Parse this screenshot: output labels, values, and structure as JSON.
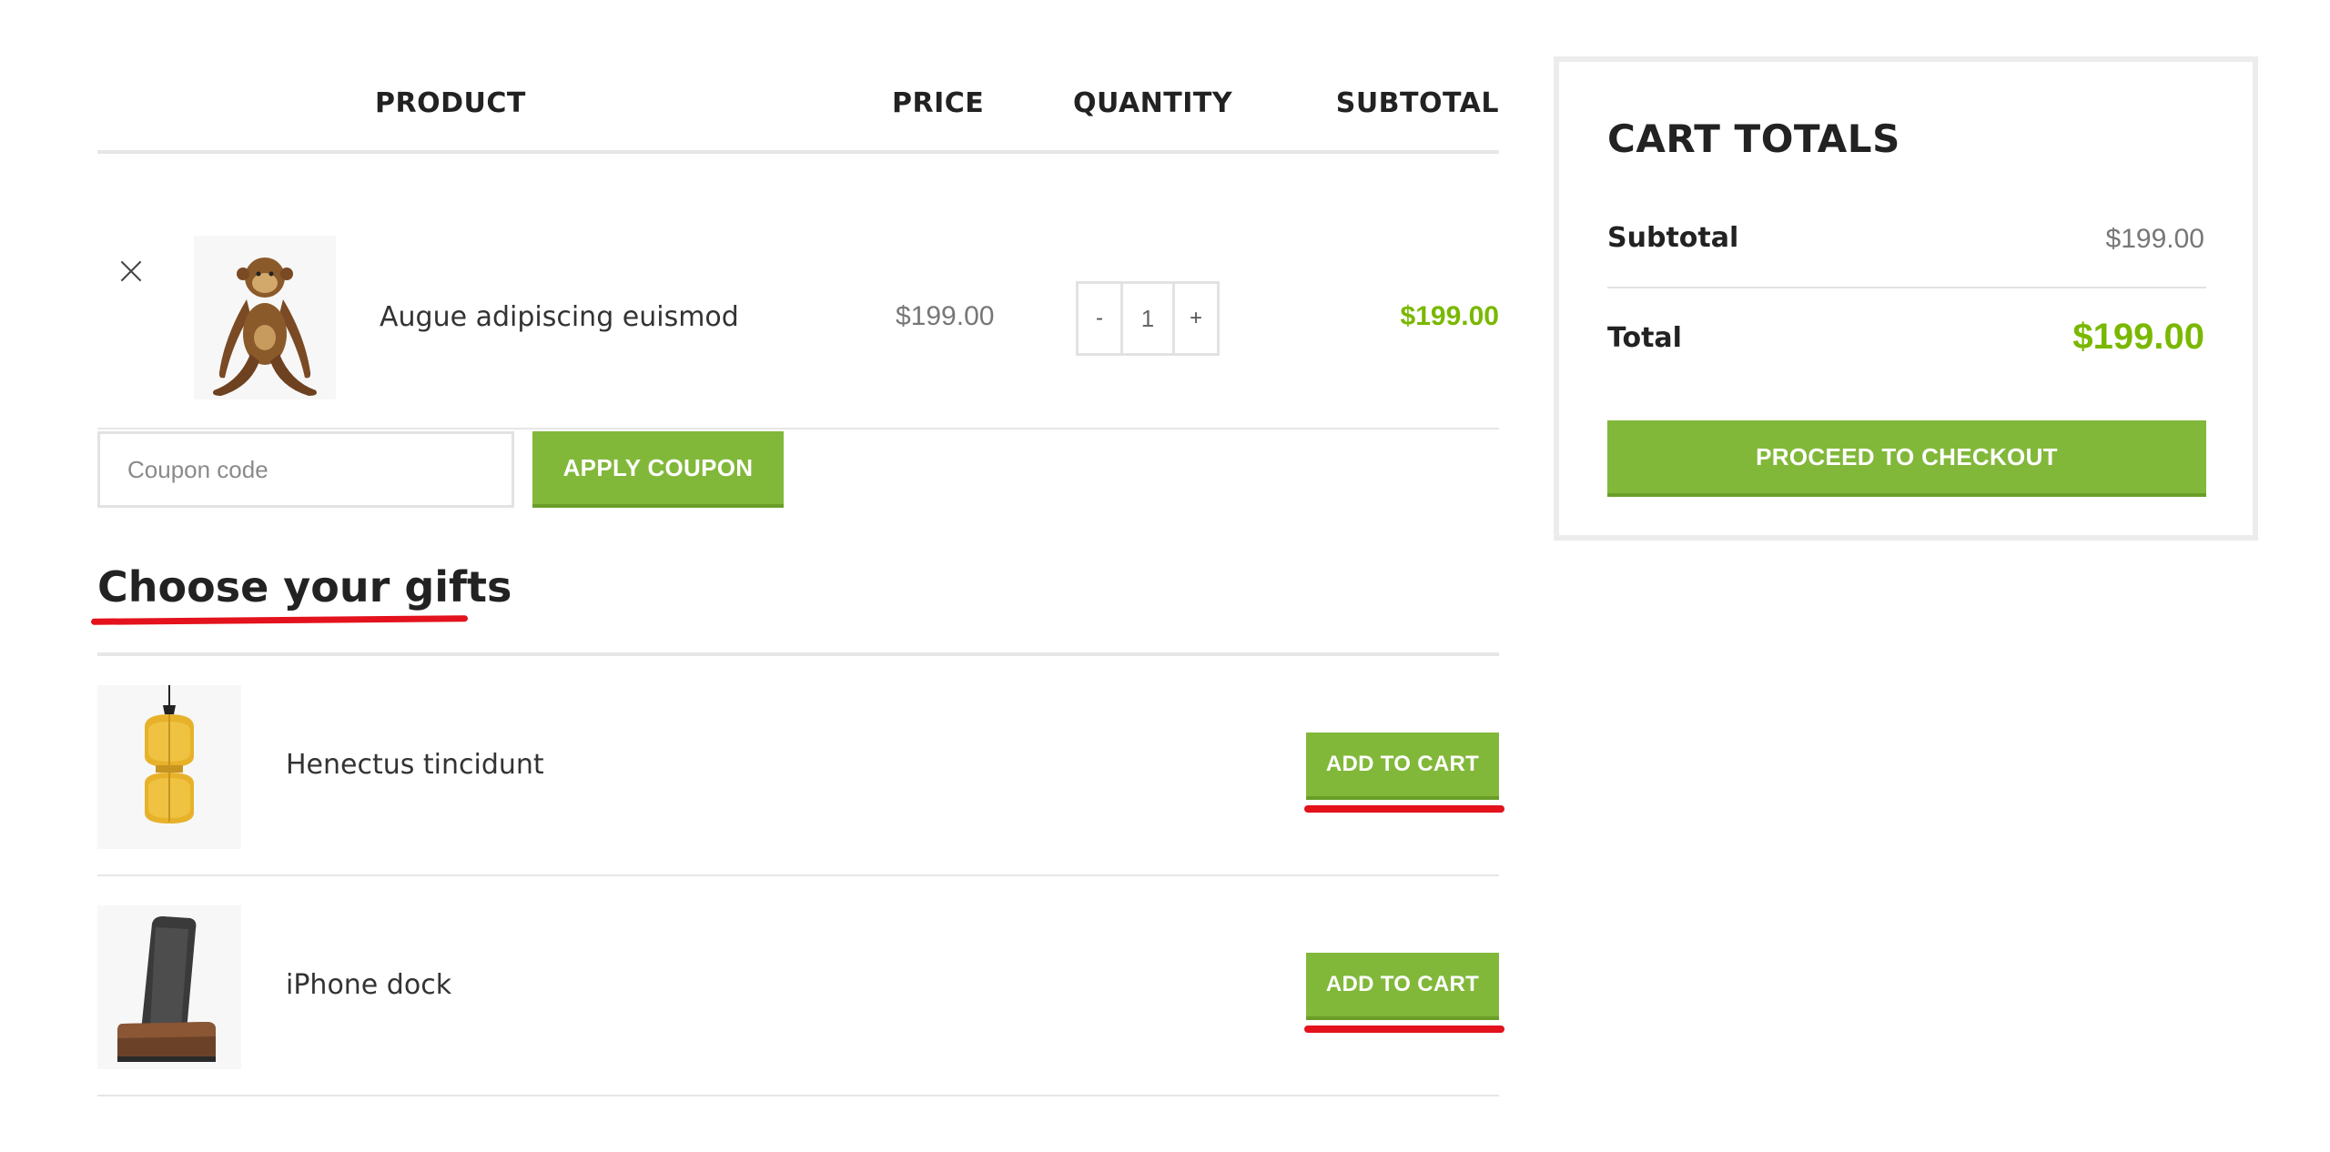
{
  "cart": {
    "headers": {
      "product": "PRODUCT",
      "price": "PRICE",
      "quantity": "QUANTITY",
      "subtotal": "SUBTOTAL"
    },
    "items": [
      {
        "name": "Augue adipiscing euismod",
        "price": "$199.00",
        "quantity": "1",
        "subtotal": "$199.00",
        "icon": "wooden-monkey-image"
      }
    ],
    "qty_minus": "-",
    "qty_plus": "+"
  },
  "coupon": {
    "placeholder": "Coupon code",
    "button_label": "APPLY COUPON"
  },
  "gifts": {
    "title": "Choose your gifts",
    "items": [
      {
        "name": "Henectus tincidunt",
        "button_label": "ADD TO CART",
        "icon": "yellow-pendant-lamp-image"
      },
      {
        "name": "iPhone dock",
        "button_label": "ADD TO CART",
        "icon": "iphone-dock-image"
      }
    ]
  },
  "totals": {
    "title": "CART TOTALS",
    "subtotal_label": "Subtotal",
    "subtotal_value": "$199.00",
    "total_label": "Total",
    "total_value": "$199.00",
    "checkout_label": "PROCEED TO CHECKOUT"
  },
  "colors": {
    "accent_green": "#82b83a",
    "price_green": "#7ab800",
    "annotation_red": "#e3121c"
  }
}
